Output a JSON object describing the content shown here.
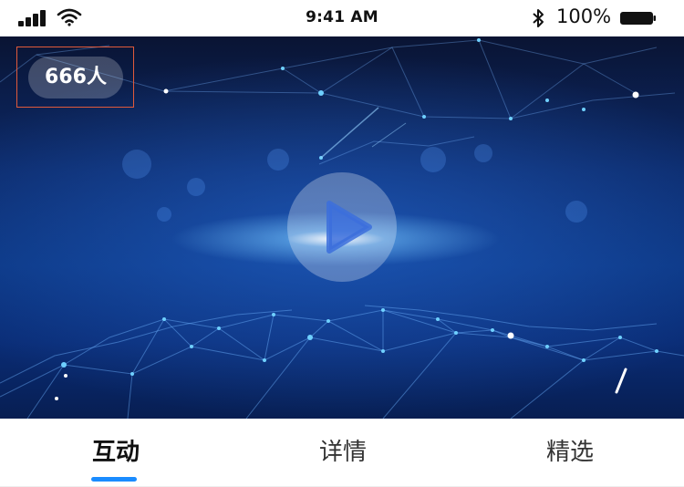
{
  "status_bar": {
    "time": "9:41 AM",
    "battery_percent": "100%",
    "icons": [
      "signal-icon",
      "wifi-icon",
      "bluetooth-icon",
      "battery-icon"
    ]
  },
  "video": {
    "viewer_count": "666人",
    "play_icon": "play-icon"
  },
  "tabs": [
    {
      "label": "互动",
      "active": true
    },
    {
      "label": "详情",
      "active": false
    },
    {
      "label": "精选",
      "active": false
    }
  ],
  "colors": {
    "accent": "#1a8cff",
    "highlight_border": "#e05a3b",
    "video_background": "#0c2a6a"
  }
}
